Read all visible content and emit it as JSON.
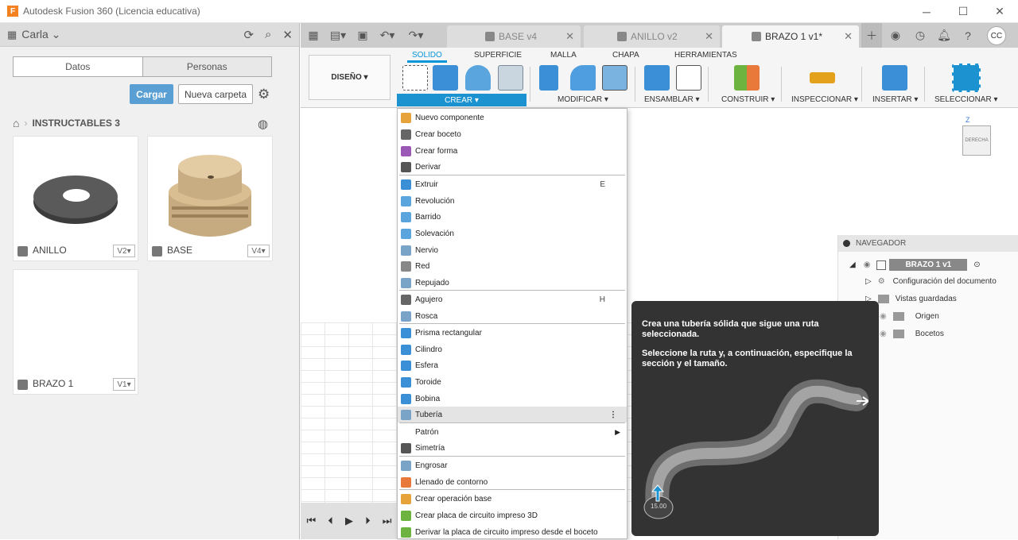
{
  "window": {
    "title": "Autodesk Fusion 360 (Licencia educativa)",
    "logo_letter": "F"
  },
  "leftpanel": {
    "user": "Carla",
    "tabs": [
      "Datos",
      "Personas"
    ],
    "upload_label": "Cargar",
    "new_folder_label": "Nueva carpeta",
    "breadcrumb": "INSTRUCTABLES 3",
    "items": [
      {
        "name": "ANILLO",
        "version": "V2▾"
      },
      {
        "name": "BASE",
        "version": "V4▾"
      },
      {
        "name": "BRAZO 1",
        "version": "V1▾"
      }
    ]
  },
  "doc_tabs": [
    {
      "label": "BASE v4"
    },
    {
      "label": "ANILLO v2"
    },
    {
      "label": "BRAZO 1 v1*"
    }
  ],
  "user_initials": "CC",
  "ribbon": {
    "tabs": [
      "SOLIDO",
      "SUPERFICIE",
      "MALLA",
      "CHAPA",
      "HERRAMIENTAS"
    ],
    "workspace": "DISEÑO ▾",
    "groups": [
      "CREAR ▾",
      "MODIFICAR ▾",
      "ENSAMBLAR ▾",
      "CONSTRUIR ▾",
      "INSPECCIONAR ▾",
      "INSERTAR ▾",
      "SELECCIONAR ▾"
    ]
  },
  "menu": {
    "items": [
      {
        "label": "Nuevo componente",
        "shortcut": ""
      },
      {
        "label": "Crear boceto",
        "shortcut": ""
      },
      {
        "label": "Crear forma",
        "shortcut": ""
      },
      {
        "label": "Derivar",
        "shortcut": ""
      },
      {
        "label": "Extruir",
        "shortcut": "E"
      },
      {
        "label": "Revolución",
        "shortcut": ""
      },
      {
        "label": "Barrido",
        "shortcut": ""
      },
      {
        "label": "Solevación",
        "shortcut": ""
      },
      {
        "label": "Nervio",
        "shortcut": ""
      },
      {
        "label": "Red",
        "shortcut": ""
      },
      {
        "label": "Repujado",
        "shortcut": ""
      },
      {
        "label": "Agujero",
        "shortcut": "H"
      },
      {
        "label": "Rosca",
        "shortcut": ""
      },
      {
        "label": "Prisma rectangular",
        "shortcut": ""
      },
      {
        "label": "Cilindro",
        "shortcut": ""
      },
      {
        "label": "Esfera",
        "shortcut": ""
      },
      {
        "label": "Toroide",
        "shortcut": ""
      },
      {
        "label": "Bobina",
        "shortcut": ""
      },
      {
        "label": "Tubería",
        "shortcut": ""
      },
      {
        "label": "Patrón",
        "shortcut": ""
      },
      {
        "label": "Simetría",
        "shortcut": ""
      },
      {
        "label": "Engrosar",
        "shortcut": ""
      },
      {
        "label": "Llenado de contorno",
        "shortcut": ""
      },
      {
        "label": "Crear operación base",
        "shortcut": ""
      },
      {
        "label": "Crear placa de circuito impreso 3D",
        "shortcut": ""
      },
      {
        "label": "Derivar la placa de circuito impreso desde el boceto",
        "shortcut": ""
      }
    ]
  },
  "tooltip": {
    "line1": "Crea una tubería sólida que sigue una ruta seleccionada.",
    "line2": "Seleccione la ruta y, a continuación, especifique la sección y el tamaño.",
    "value": "15.00"
  },
  "navigator": {
    "title": "NAVEGADOR",
    "root": "BRAZO 1 v1",
    "nodes": [
      "Configuración del documento",
      "Vistas guardadas",
      "Origen",
      "Bocetos"
    ]
  },
  "viewcube": {
    "face": "DERECHA",
    "axis_z": "Z"
  }
}
